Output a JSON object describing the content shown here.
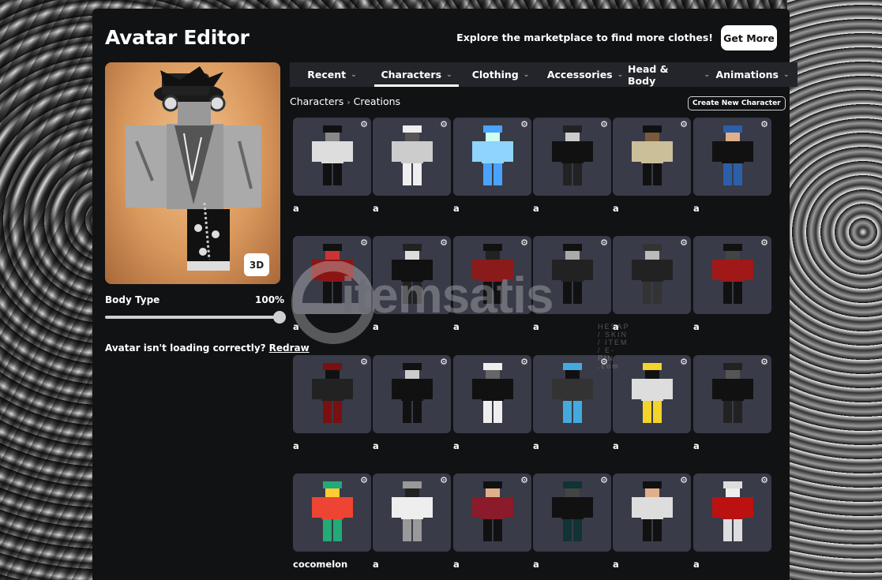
{
  "header": {
    "title": "Avatar Editor",
    "marketplace_text": "Explore the marketplace to find more clothes!",
    "get_more_label": "Get More"
  },
  "avatar_panel": {
    "view_3d_label": "3D",
    "body_type_label": "Body Type",
    "body_type_value": "100%",
    "body_type_fraction": 1.0,
    "loading_text": "Avatar isn't loading correctly?",
    "redraw_label": "Redraw"
  },
  "tabs": [
    {
      "label": "Recent"
    },
    {
      "label": "Characters",
      "active": true
    },
    {
      "label": "Clothing"
    },
    {
      "label": "Accessories"
    },
    {
      "label": "Head & Body"
    },
    {
      "label": "Animations"
    }
  ],
  "breadcrumb": {
    "parent": "Characters",
    "current": "Creations"
  },
  "create_new_label": "Create New Character",
  "characters": [
    {
      "name": "a"
    },
    {
      "name": "a"
    },
    {
      "name": "a"
    },
    {
      "name": "a"
    },
    {
      "name": "a"
    },
    {
      "name": "a"
    },
    {
      "name": "a"
    },
    {
      "name": "a"
    },
    {
      "name": "a"
    },
    {
      "name": "a"
    },
    {
      "name": "a"
    },
    {
      "name": "a"
    },
    {
      "name": "a"
    },
    {
      "name": "a"
    },
    {
      "name": "a"
    },
    {
      "name": "a"
    },
    {
      "name": "a"
    },
    {
      "name": "a"
    },
    {
      "name": "cocomelon"
    },
    {
      "name": "a"
    },
    {
      "name": "a"
    },
    {
      "name": "a"
    },
    {
      "name": "a"
    },
    {
      "name": "a"
    }
  ],
  "watermark": {
    "brand": "itemsatis",
    "tagline": "HESAP / SKIN / ITEM / E-PIN .com"
  },
  "colors": {
    "panel_bg": "#111214",
    "card_bg": "#393b48",
    "tabbar_bg": "#23252b",
    "accent": "#ffffff"
  },
  "icons": {
    "gear": "settings-gear-icon",
    "chevron": "chevron-down-icon"
  }
}
